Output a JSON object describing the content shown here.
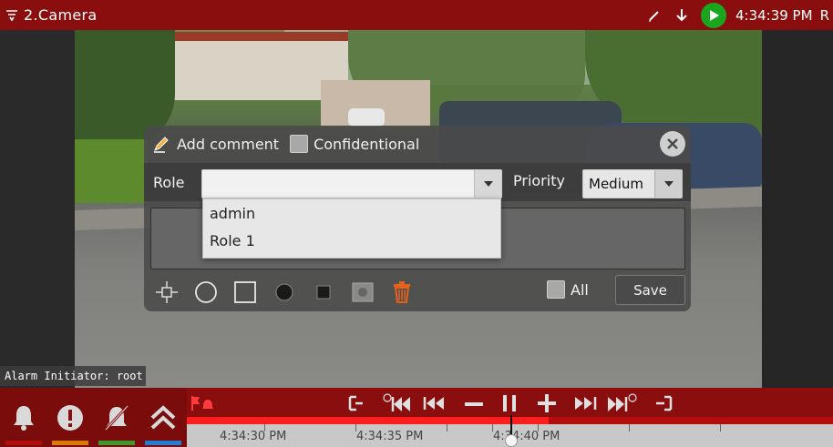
{
  "titlebar": {
    "title": "2.Camera",
    "time": "4:34:39 PM",
    "rec_label": "R",
    "icons": [
      "menu-icon",
      "edit-icon",
      "download-icon",
      "play-icon"
    ]
  },
  "comment_panel": {
    "add_comment_label": "Add comment",
    "confidential_label": "Confidentional",
    "role_label": "Role",
    "role_value": "",
    "priority_label": "Priority",
    "priority_value": "Medium",
    "role_options": [
      "admin",
      "Role 1"
    ],
    "all_label": "All",
    "save_label": "Save",
    "tools": [
      "crosshair-icon",
      "circle-outline-icon",
      "square-outline-icon",
      "circle-filled-icon",
      "square-filled-icon",
      "snapshot-icon",
      "trash-icon"
    ]
  },
  "alarm_initiator": "Alarm Initiator: root",
  "alarm_buttons": [
    {
      "icon": "bell-icon",
      "color": "#b30d0d"
    },
    {
      "icon": "exclamation-icon",
      "color": "#d97a00"
    },
    {
      "icon": "mute-bell-icon",
      "color": "#3a9a2a"
    },
    {
      "icon": "chevron-up-double-icon",
      "color": "#1f7fd8"
    }
  ],
  "timeline": {
    "labels": [
      "4:34:30 PM",
      "4:34:35 PM",
      "4:34:40 PM"
    ],
    "progress": 0.56
  },
  "colors": {
    "titlebar": "#8a0e0e",
    "play": "#19a51e",
    "trash": "#e5621c"
  }
}
